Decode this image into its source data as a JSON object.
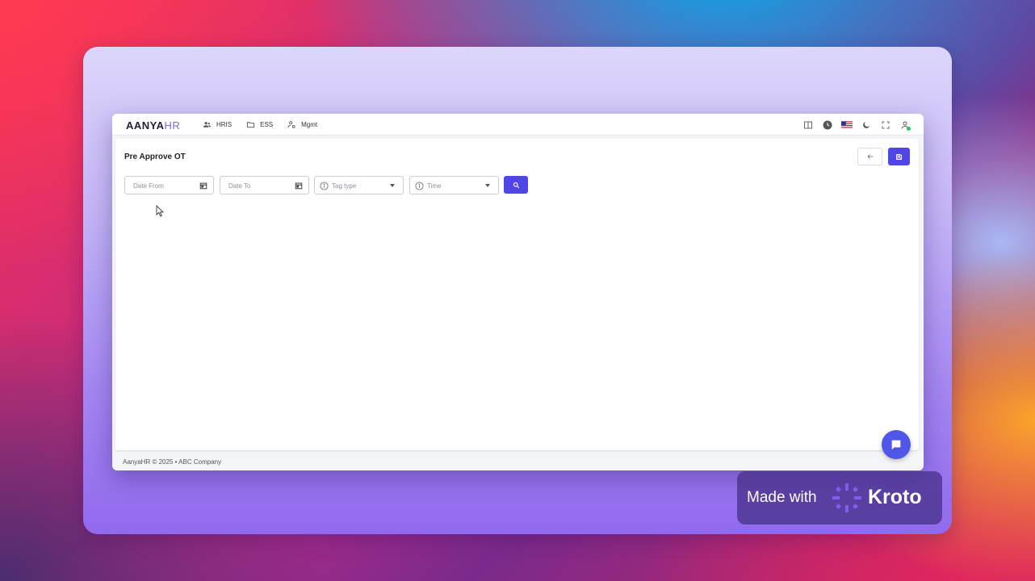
{
  "app": {
    "logo_main": "AANYA",
    "logo_accent": "HR"
  },
  "nav": {
    "items": [
      {
        "label": "HRIS",
        "icon": "people-icon"
      },
      {
        "label": "ESS",
        "icon": "folder-icon"
      },
      {
        "label": "Mgmt",
        "icon": "user-settings-icon"
      }
    ]
  },
  "top_icons": [
    "book-icon",
    "clock-icon",
    "us-flag-icon",
    "moon-icon",
    "fullscreen-icon",
    "user-icon"
  ],
  "page": {
    "title": "Pre Approve OT"
  },
  "filters": {
    "date_from_placeholder": "Date From",
    "date_to_placeholder": "Date To",
    "tag_type_placeholder": "Tag type",
    "time_placeholder": "Time"
  },
  "footer": {
    "text": "AanyaHR © 2025 • ABC Company"
  },
  "badge": {
    "made_with": "Made with",
    "brand": "Kroto"
  },
  "colors": {
    "accent": "#4f46e5",
    "online": "#22c55e"
  }
}
